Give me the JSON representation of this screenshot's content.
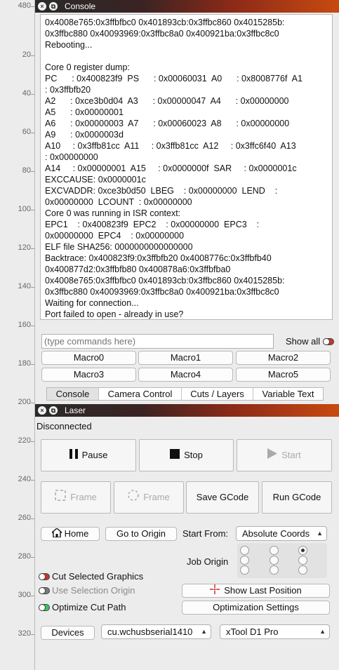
{
  "ruler": {
    "ticks": [
      "480",
      "20",
      "40",
      "60",
      "80",
      "100",
      "120",
      "140",
      "160",
      "180",
      "200",
      "220",
      "240",
      "260",
      "280",
      "300",
      "320"
    ]
  },
  "console_panel": {
    "title": "Console",
    "output_lines": [
      "0x4008e765:0x3ffbfbc0 0x401893cb:0x3ffbc860 0x4015285b:",
      "0x3ffbc880 0x40093969:0x3ffbc8a0 0x400921ba:0x3ffbc8c0",
      "Rebooting...",
      "",
      "Core 0 register dump:",
      "PC      : 0x400823f9  PS      : 0x00060031  A0      : 0x8008776f  A1",
      ": 0x3ffbfb20",
      "A2      : 0xce3b0d04  A3      : 0x00000047  A4      : 0x00000000",
      "A5      : 0x00000001",
      "A6      : 0x00000003  A7      : 0x00060023  A8      : 0x00000000",
      "A9      : 0x0000003d",
      "A10     : 0x3ffb81cc  A11     : 0x3ffb81cc  A12     : 0x3ffc6f40  A13",
      ": 0x00000000",
      "A14     : 0x00000001  A15     : 0x0000000f  SAR     : 0x0000001c",
      "EXCCAUSE: 0x0000001c",
      "EXCVADDR: 0xce3b0d50  LBEG    : 0x00000000  LEND    :",
      "0x00000000  LCOUNT  : 0x00000000",
      "Core 0 was running in ISR context:",
      "EPC1    : 0x400823f9  EPC2    : 0x00000000  EPC3    :",
      "0x00000000  EPC4    : 0x00000000",
      "ELF file SHA256: 0000000000000000",
      "Backtrace: 0x400823f9:0x3ffbfb20 0x4008776c:0x3ffbfb40",
      "0x400877d2:0x3ffbfb80 0x400878a6:0x3ffbfba0",
      "0x4008e765:0x3ffbfbc0 0x401893cb:0x3ffbc860 0x4015285b:",
      "0x3ffbc880 0x40093969:0x3ffbc8a0 0x400921ba:0x3ffbc8c0",
      "Waiting for connection...",
      "Port failed to open - already in use?"
    ],
    "command_placeholder": "(type commands here)",
    "show_all_label": "Show all",
    "macros": [
      "Macro0",
      "Macro1",
      "Macro2",
      "Macro3",
      "Macro4",
      "Macro5"
    ],
    "tabs": [
      "Console",
      "Camera Control",
      "Cuts / Layers",
      "Variable Text"
    ],
    "active_tab": "Console"
  },
  "laser_panel": {
    "title": "Laser",
    "status": "Disconnected",
    "pause_label": "Pause",
    "stop_label": "Stop",
    "start_label": "Start",
    "frame_rect_label": "Frame",
    "frame_circle_label": "Frame",
    "save_gcode_label": "Save GCode",
    "run_gcode_label": "Run GCode",
    "home_label": "Home",
    "go_to_origin_label": "Go to Origin",
    "start_from_label": "Start From:",
    "start_from_value": "Absolute Coords",
    "job_origin_label": "Job Origin",
    "job_origin_selected": "top-right",
    "cut_selected_label": "Cut Selected Graphics",
    "use_selection_origin_label": "Use Selection Origin",
    "optimize_cut_path_label": "Optimize Cut Path",
    "show_last_position_label": "Show Last Position",
    "optimization_settings_label": "Optimization Settings",
    "devices_label": "Devices",
    "port_value": "cu.wchusbserial1410",
    "device_value": "xTool D1 Pro"
  },
  "colors": {
    "titlebar_gradient_end": "#c84a10",
    "toggle_on_red": "#c9342a",
    "toggle_on_green": "#34c759",
    "crosshair_red": "#d0302a"
  }
}
